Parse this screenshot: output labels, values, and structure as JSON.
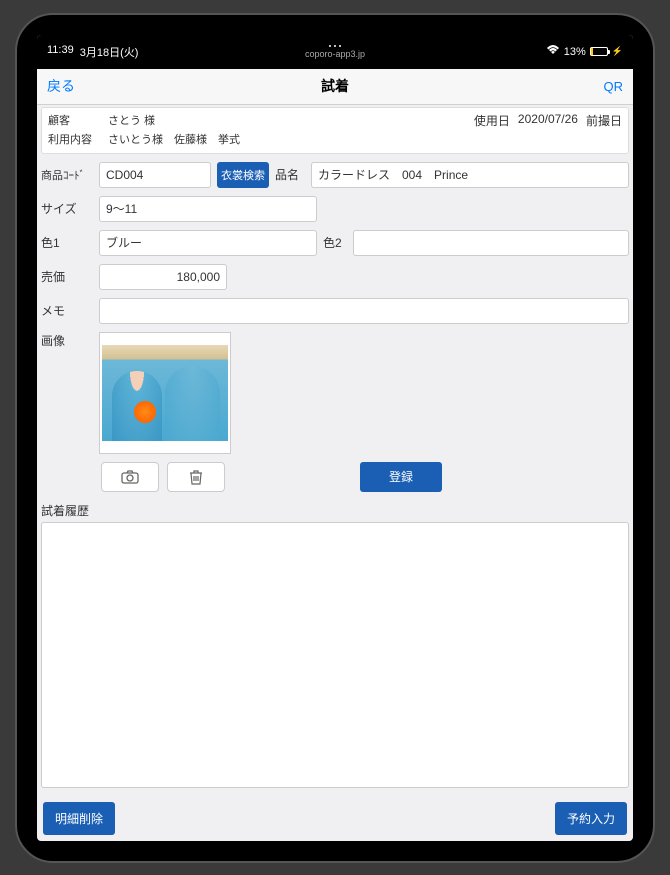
{
  "status": {
    "time": "11:39",
    "date": "3月18日(火)",
    "url": "coporo-app3.jp",
    "battery": "13%"
  },
  "nav": {
    "back": "戻る",
    "title": "試着",
    "qr": "QR"
  },
  "customer": {
    "customer_label": "顧客",
    "customer_name": "さとう 様",
    "usage_label": "利用内容",
    "usage_value": "さいとう様　佐藤様　挙式",
    "date_label": "使用日",
    "date_value": "2020/07/26",
    "prev_label": "前撮日"
  },
  "form": {
    "code_label": "商品ｺｰﾄﾞ",
    "code_value": "CD004",
    "search_btn": "衣裳検索",
    "name_label": "品名",
    "name_value": "カラードレス　004　Prince",
    "size_label": "サイズ",
    "size_value": "9～11",
    "color1_label": "色1",
    "color1_value": "ブルー",
    "color2_label": "色2",
    "color2_value": "",
    "price_label": "売価",
    "price_value": "180,000",
    "memo_label": "メモ",
    "memo_value": "",
    "image_label": "画像",
    "register_btn": "登録",
    "history_label": "試着履歴"
  },
  "footer": {
    "delete_btn": "明細削除",
    "reserve_btn": "予約入力"
  }
}
